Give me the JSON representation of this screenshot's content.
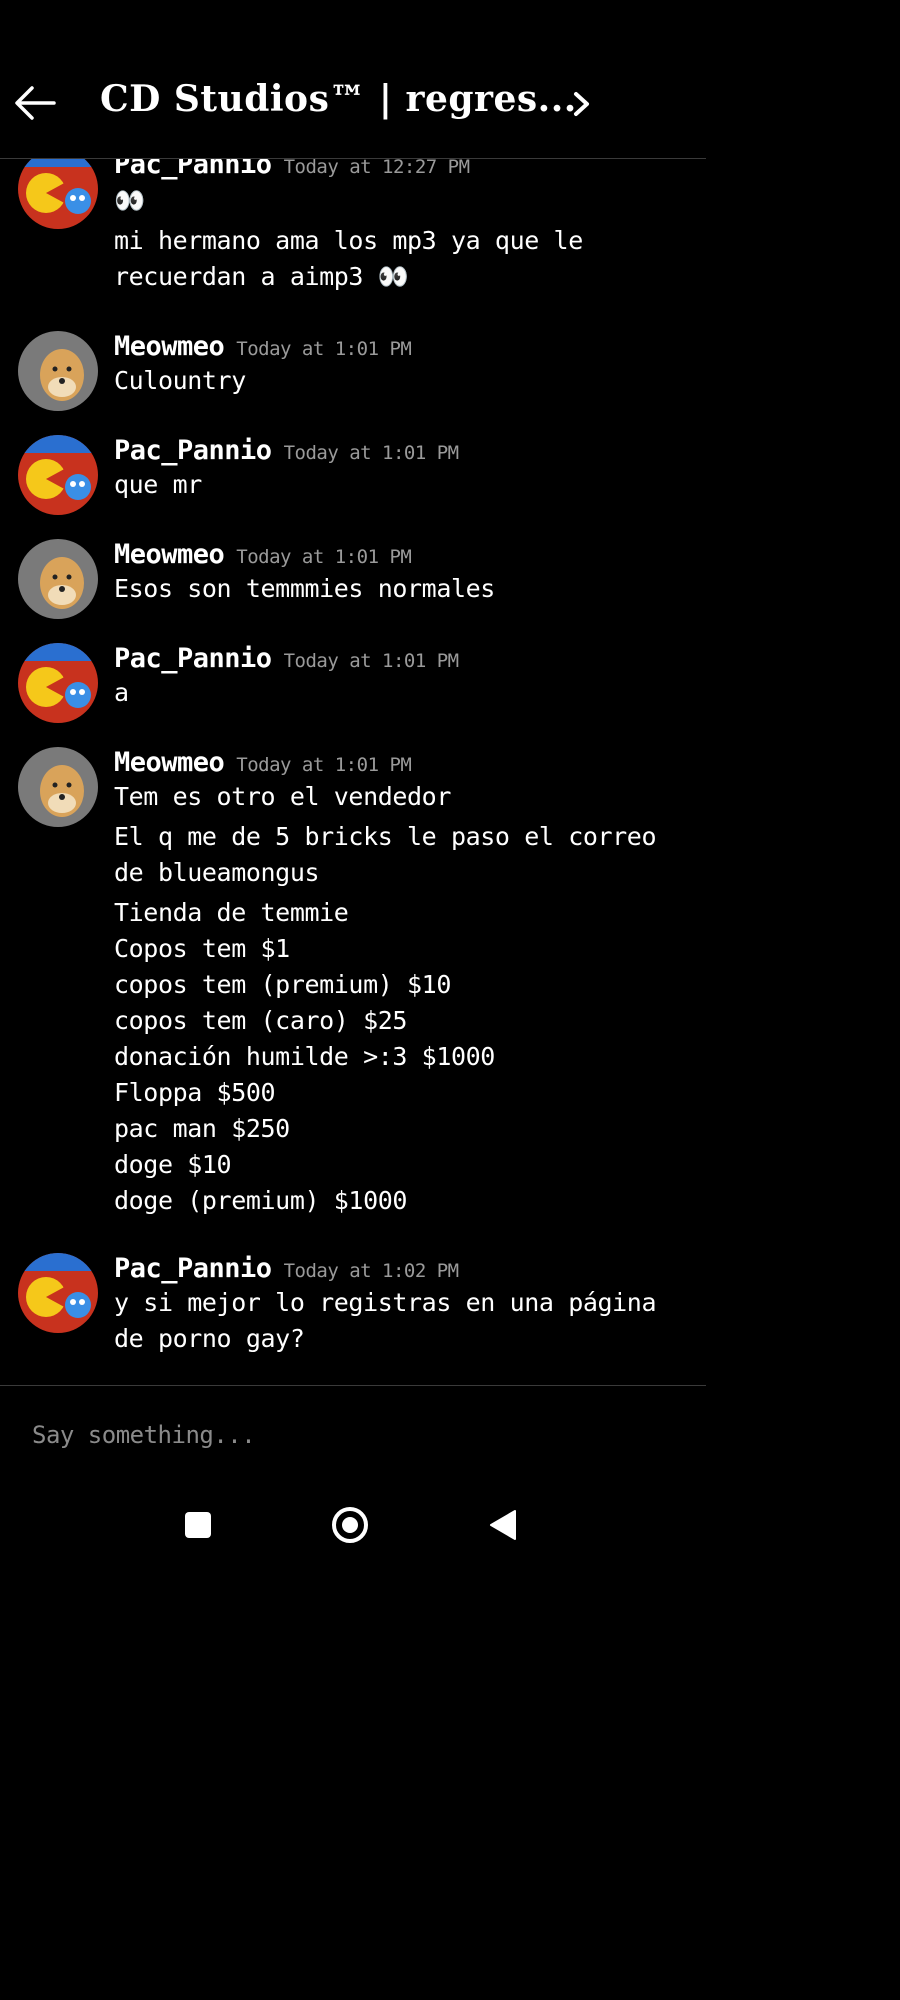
{
  "header": {
    "title": "CD Studios™ | regres...",
    "back_icon": "arrow-left-icon",
    "chevron_icon": "chevron-right-icon"
  },
  "messages": [
    {
      "author": "Pac_Pannio",
      "time": "Today at 12:27 PM",
      "avatar": "pacman-avatar",
      "lines": [
        "👀",
        "mi hermano ama los mp3 ya que le recuerdan a aimp3 👀"
      ]
    },
    {
      "author": "Meowmeo",
      "time": "Today at 1:01 PM",
      "avatar": "doge-avatar",
      "lines": [
        "Culountry"
      ]
    },
    {
      "author": "Pac_Pannio",
      "time": "Today at 1:01 PM",
      "avatar": "pacman-avatar",
      "lines": [
        "que mr"
      ]
    },
    {
      "author": "Meowmeo",
      "time": "Today at 1:01 PM",
      "avatar": "doge-avatar",
      "lines": [
        "Esos son temmmies normales"
      ]
    },
    {
      "author": "Pac_Pannio",
      "time": "Today at 1:01 PM",
      "avatar": "pacman-avatar",
      "lines": [
        "a"
      ]
    },
    {
      "author": "Meowmeo",
      "time": "Today at 1:01 PM",
      "avatar": "doge-avatar",
      "lines": [
        "Tem es otro el vendedor",
        "El q me de 5 bricks le paso el correo de blueamongus",
        "Tienda de temmie\nCopos tem $1\ncopos tem (premium) $10\ncopos tem (caro) $25\ndonación humilde >:3 $1000\nFloppa $500\npac man $250\ndoge $10\ndoge (premium) $1000"
      ]
    },
    {
      "author": "Pac_Pannio",
      "time": "Today at 1:02 PM",
      "avatar": "pacman-avatar",
      "lines": [
        "y si mejor lo registras en una página de porno gay?"
      ]
    }
  ],
  "composer": {
    "placeholder": "Say something..."
  },
  "navbar": {
    "icons": [
      "square-icon",
      "circle-home-icon",
      "triangle-back-icon"
    ]
  },
  "colors": {
    "background": "#000000",
    "text": "#ffffff",
    "timestamp": "#9a9a9a",
    "divider": "#3a3a3a"
  }
}
